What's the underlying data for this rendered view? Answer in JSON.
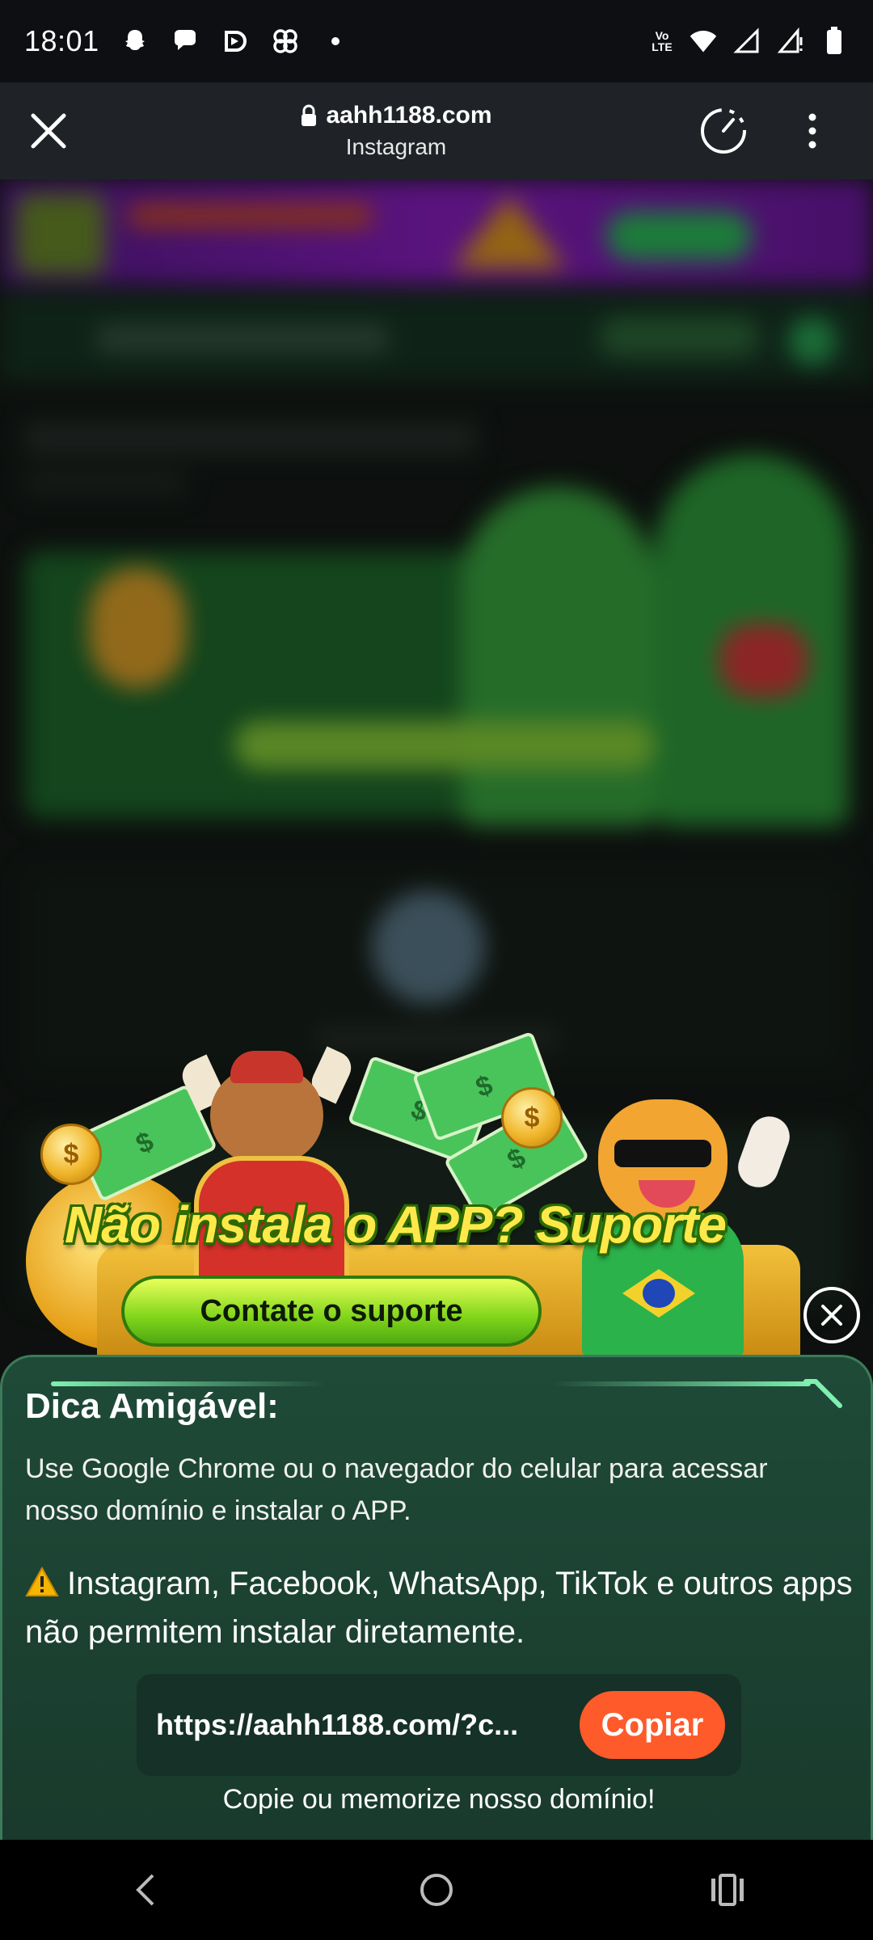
{
  "status_bar": {
    "time": "18:01",
    "notification_icons": [
      "snapchat-icon",
      "chat-bubble-icon",
      "media-icon",
      "pinwheel-icon",
      "dot-icon"
    ],
    "network_label": "Vo LTE",
    "system_icons": [
      "wifi-icon",
      "signal-icon",
      "signal-x-icon",
      "battery-icon"
    ]
  },
  "browser": {
    "domain": "aahh1188.com",
    "subtitle": "Instagram"
  },
  "banner": {
    "headline": "Não instala o APP? Suporte",
    "button_label": "Contate o suporte",
    "bill_symbol": "$"
  },
  "sheet": {
    "title": "Dica Amigável:",
    "description": "Use Google Chrome ou o navegador do celular para acessar nosso domínio e instalar o APP.",
    "warning": "Instagram, Facebook, WhatsApp, TikTok e outros apps não permitem instalar diretamente.",
    "url_value": "https://aahh1188.com/?c...",
    "copy_label": "Copiar",
    "footer": "Copie ou memorize nosso domínio!"
  },
  "colors": {
    "sheet_bg": "#1f4a38",
    "copy_button": "#ff5a2a",
    "headline_yellow": "#ffe94a",
    "support_button_green": "#7fd51a"
  }
}
